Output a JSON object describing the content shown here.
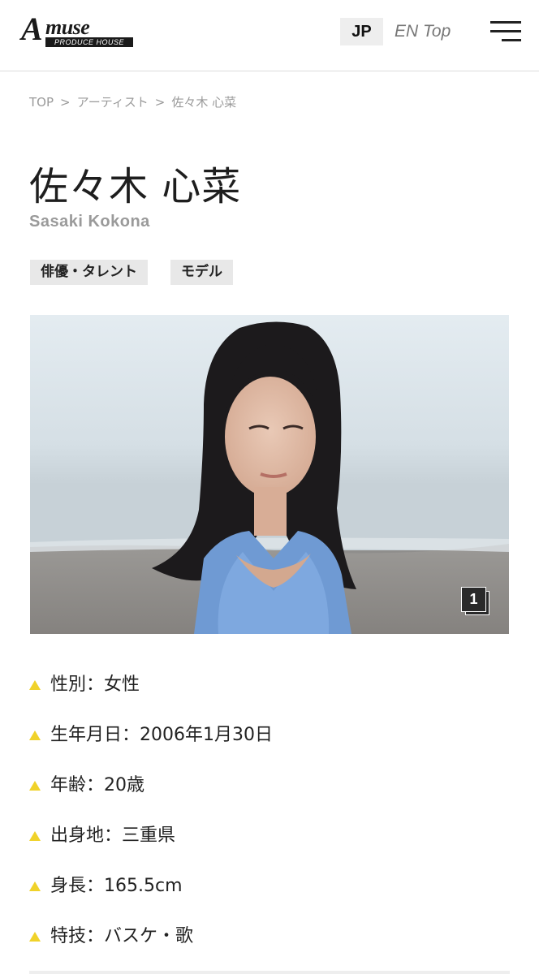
{
  "header": {
    "logo_main": "muse",
    "logo_initial": "A",
    "logo_sub": "PRODUCE HOUSE",
    "lang_jp": "JP",
    "lang_en": "EN Top"
  },
  "breadcrumb": {
    "items": [
      "TOP",
      "アーティスト",
      "佐々木 心菜"
    ],
    "separator": ">"
  },
  "artist": {
    "name": "佐々木 心菜",
    "romaji": "Sasaki Kokona",
    "tags": [
      "俳優・タレント",
      "モデル"
    ]
  },
  "photo": {
    "count": "1"
  },
  "profile": [
    "性別：女性",
    "生年月日：2006年1月30日",
    "年齢：20歳",
    "出身地：三重県",
    "身長：165.5cm",
    "特技：バスケ・歌"
  ],
  "colors": {
    "bullet": "#f0d22a",
    "tag_bg": "#e8e8e8",
    "muted_text": "#9a9a9a"
  },
  "icons": {
    "menu": "hamburger-menu-icon",
    "bullet": "triangle-bullet-icon",
    "gallery": "photo-stack-icon"
  }
}
